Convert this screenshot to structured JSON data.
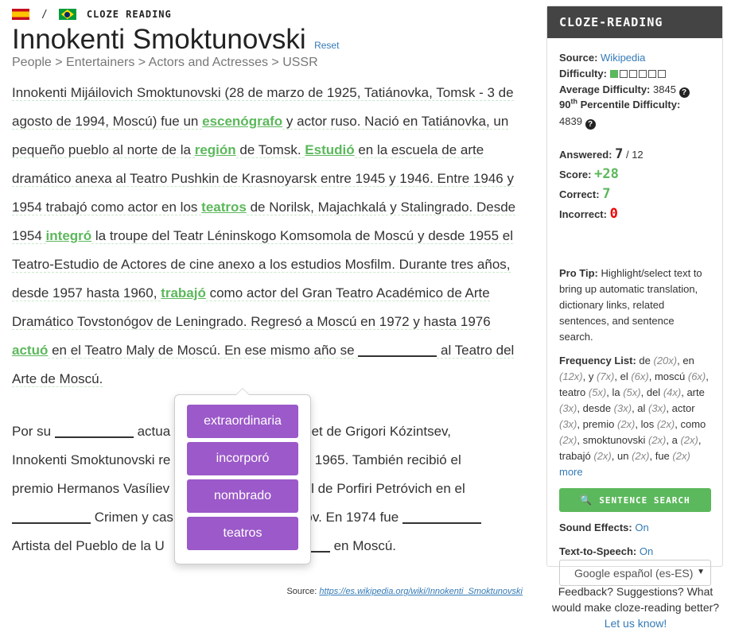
{
  "header": {
    "source_flag": "flag-es-icon",
    "target_flag": "flag-br-icon",
    "separator": "/",
    "app_name": "CLOZE READING"
  },
  "article": {
    "title": "Innokenti Smoktunovski",
    "reset_label": "Reset",
    "breadcrumb": "People > Entertainers > Actors and Actresses > USSR"
  },
  "passage": {
    "p1": [
      "Innokenti Mijáilovich Smoktunovski (28 de marzo de 1925, Tatiánovka, Tomsk - 3 de agosto de 1994, Moscú) fue un ",
      "escenógrafo",
      " y actor ruso. Nació en Tatiánovka, un pequeño pueblo al norte de la ",
      "región",
      " de Tomsk. ",
      "Estudió",
      " en la escuela de arte dramático anexa al Teatro Pushkin de Krasnoyarsk entre 1945 y 1946. Entre 1946 y 1954 trabajó como actor en los ",
      "teatros",
      " de Norilsk, Majachkalá y Stalingrado. Desde 1954 ",
      "integró",
      " la troupe del Teatr Léninskogo Komsomola de Moscú y desde 1955 el Teatro-Estudio de Actores de cine anexo a los estudios Mosfilm. Durante tres años, desde 1957 hasta 1960, ",
      "trabajó",
      " como actor del Gran Teatro Académico de Arte Dramático Tovstonógov de Leningrado. Regresó a Moscú en 1972 y hasta 1976 ",
      "actuó",
      " en el Teatro Maly de Moscú. En ese mismo año se ",
      " al Teatro del Arte de Moscú."
    ],
    "p2": [
      "Por su ",
      " actua",
      "amlet de Grigori Kózintsev,",
      "Innokenti Smoktunovski re",
      " en 1965. También recibió el",
      "premio Hermanos Vasíliev",
      "l de Porfiri Petróvich en el",
      " Crimen y cas",
      "nov. En 1974 fue ",
      "Artista del Pueblo de la U",
      " en Moscú."
    ]
  },
  "choices": [
    "extraordinaria",
    "incorporó",
    "nombrado",
    "teatros"
  ],
  "source": {
    "label": "Source:",
    "url": "https://es.wikipedia.org/wiki/Innokenti_Smoktunovski"
  },
  "sidebar": {
    "title": "CLOZE-READING",
    "source_label": "Source:",
    "source_value": "Wikipedia",
    "difficulty_label": "Difficulty:",
    "difficulty_level": 1,
    "difficulty_max": 6,
    "avg_difficulty_label": "Average Difficulty:",
    "avg_difficulty_value": "3845",
    "percentile_label_pre": "90",
    "percentile_label_sup": "th",
    "percentile_label_post": " Percentile Difficulty:",
    "percentile_value": "4839",
    "answered_label": "Answered:",
    "answered_value": "7",
    "answered_total": "/ 12",
    "score_label": "Score:",
    "score_value": "+28",
    "correct_label": "Correct:",
    "correct_value": "7",
    "incorrect_label": "Incorrect:",
    "incorrect_value": "0",
    "protip_label": "Pro Tip:",
    "protip_text": " Highlight/select text to bring up automatic translation, dictionary links, related sentences, and sentence search.",
    "freq_label": "Frequency List:",
    "freq_items": [
      {
        "word": "de",
        "count": "(20x)"
      },
      {
        "word": "en",
        "count": "(12x)"
      },
      {
        "word": "y",
        "count": "(7x)"
      },
      {
        "word": "el",
        "count": "(6x)"
      },
      {
        "word": "moscú",
        "count": "(6x)"
      },
      {
        "word": "teatro",
        "count": "(5x)"
      },
      {
        "word": "la",
        "count": "(5x)"
      },
      {
        "word": "del",
        "count": "(4x)"
      },
      {
        "word": "arte",
        "count": "(3x)"
      },
      {
        "word": "desde",
        "count": "(3x)"
      },
      {
        "word": "al",
        "count": "(3x)"
      },
      {
        "word": "actor",
        "count": "(3x)"
      },
      {
        "word": "premio",
        "count": "(2x)"
      },
      {
        "word": "los",
        "count": "(2x)"
      },
      {
        "word": "como",
        "count": "(2x)"
      },
      {
        "word": "smoktunovski",
        "count": "(2x)"
      },
      {
        "word": "a",
        "count": "(2x)"
      },
      {
        "word": "trabajó",
        "count": "(2x)"
      },
      {
        "word": "un",
        "count": "(2x)"
      },
      {
        "word": "fue",
        "count": "(2x)"
      }
    ],
    "freq_more": "more",
    "search_button": "SENTENCE SEARCH",
    "sound_label": "Sound Effects:",
    "sound_value": "On",
    "tts_label": "Text-to-Speech:",
    "tts_value": "On",
    "voice_selected": "Google español (es-ES)"
  },
  "feedback": {
    "text": "Feedback? Suggestions? What would make cloze-reading better?",
    "link": "Let us know!"
  }
}
